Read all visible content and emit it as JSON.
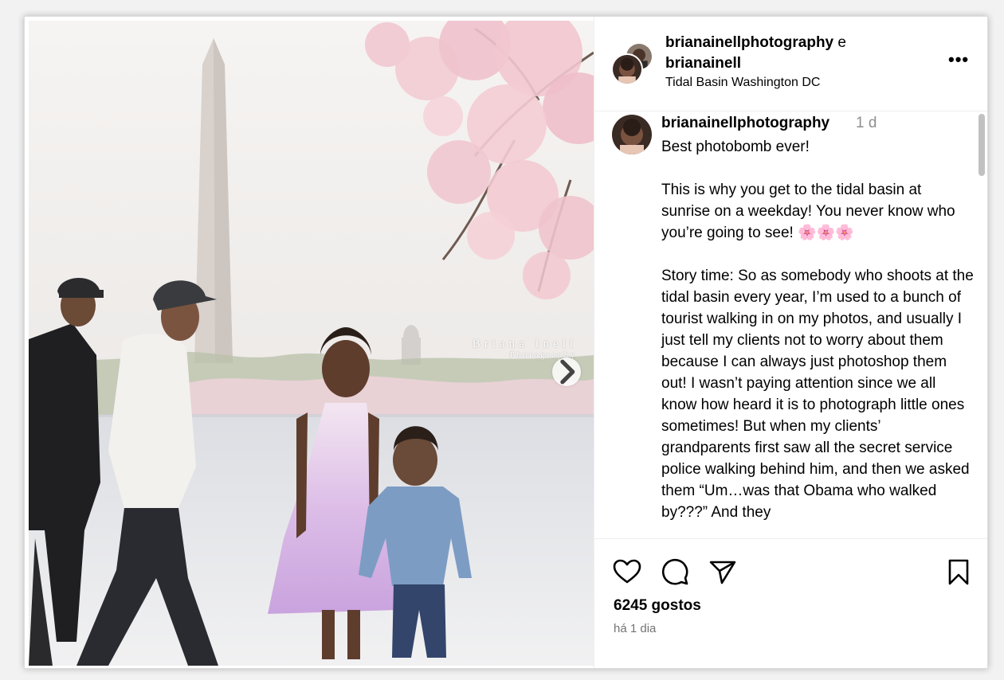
{
  "post": {
    "header": {
      "username_primary": "brianainellphotography",
      "joiner": "e",
      "username_secondary": "brianainell",
      "location": "Tidal Basin Washington DC",
      "more_icon": "more-horizontal-icon",
      "more_label": "•••"
    },
    "image": {
      "watermark_main": "Briana Inell",
      "watermark_sub": "Photography",
      "next_icon": "chevron-right-icon"
    },
    "caption": {
      "username": "brianainellphotography",
      "time": "1 d",
      "paragraphs": [
        "Best photobomb ever!",
        "This is why you get to the tidal basin at sunrise on a weekday! You never know who you’re going to see! 🌸🌸🌸",
        "Story time: So as somebody who shoots at the tidal basin every year, I’m used to a bunch of tourist walking in on my photos, and usually I just tell my clients not to worry about them because I can always just photoshop them out! I wasn’t paying attention since we all know how heard it is to photograph little ones sometimes! But when my clients’ grandparents first saw all the secret service police walking behind him, and then we asked them “Um…was that Obama who walked by???” And they"
      ]
    },
    "actions": {
      "like_icon": "heart-icon",
      "comment_icon": "comment-icon",
      "share_icon": "send-icon",
      "save_icon": "bookmark-icon"
    },
    "likes": "6245 gostos",
    "date": "há 1 dia"
  },
  "colors": {
    "text": "#000000",
    "secondary_text": "#8e8e8e",
    "divider": "#efefef",
    "blossom": "#f0c6cf",
    "dress": "#d9b6e6",
    "denim": "#7d9cc4"
  }
}
